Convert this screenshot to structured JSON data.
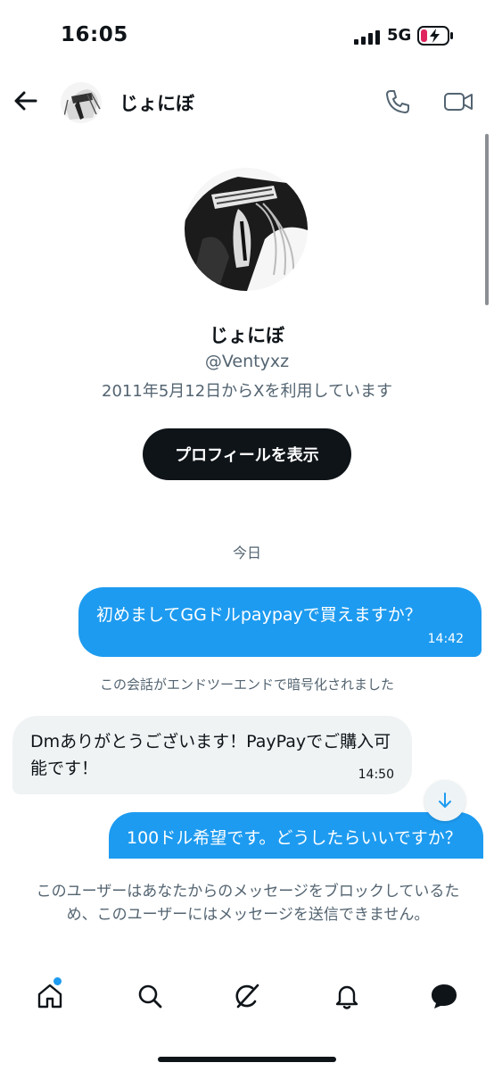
{
  "status_bar": {
    "time": "16:05",
    "network": "5G"
  },
  "header": {
    "name": "じょにぼ"
  },
  "profile": {
    "name": "じょにぼ",
    "handle": "@Ventyxz",
    "joined": "2011年5月12日からXを利用しています",
    "view_profile_label": "プロフィールを表示"
  },
  "conversation": {
    "day_label": "今日",
    "encryption_notice": "この会話がエンドツーエンドで暗号化されました",
    "messages": [
      {
        "direction": "outgoing",
        "text": "初めましてGGドルpaypayで買えますか？",
        "time": "14:42"
      },
      {
        "direction": "incoming",
        "text": "Dmありがとうございます！PayPayでご購入可能です！",
        "time": "14:50"
      },
      {
        "direction": "outgoing",
        "text": "100ドル希望です。どうしたらいいですか？",
        "time": ""
      }
    ]
  },
  "block_notice": "このユーザーはあなたからのメッセージをブロックしているため、このユーザーにはメッセージを送信できません。",
  "tab_bar": {
    "items": [
      {
        "icon": "home-icon",
        "active": false,
        "has_dot": true
      },
      {
        "icon": "search-icon",
        "active": false
      },
      {
        "icon": "grok-icon",
        "active": false
      },
      {
        "icon": "bell-icon",
        "active": false
      },
      {
        "icon": "messages-icon",
        "active": true
      }
    ]
  },
  "colors": {
    "accent": "#1d9bf0",
    "text": "#0f1419",
    "muted": "#536471",
    "incoming_bubble": "#eff3f4"
  }
}
